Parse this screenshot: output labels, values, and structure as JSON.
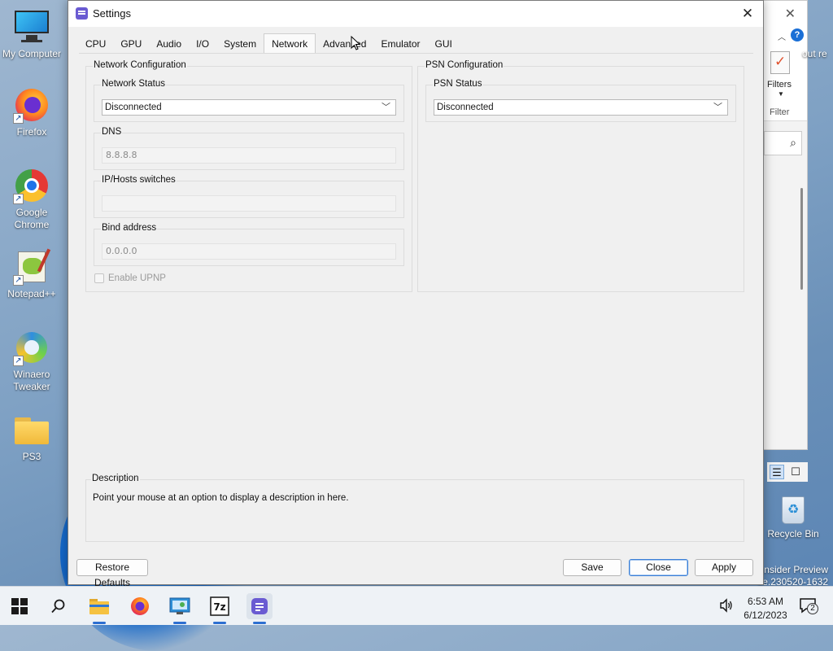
{
  "desktop": {
    "icons": [
      {
        "label": "My Computer",
        "icon": "computer-icon"
      },
      {
        "label": "Firefox",
        "icon": "firefox-icon"
      },
      {
        "label": "Google Chrome",
        "icon": "chrome-icon"
      },
      {
        "label": "Notepad++",
        "icon": "notepadpp-icon"
      },
      {
        "label": "Winaero Tweaker",
        "icon": "winaero-icon"
      },
      {
        "label": "PS3",
        "icon": "folder-icon"
      }
    ],
    "recycle_bin": "Recycle Bin",
    "partial_right_label": "out re",
    "watermark_line1": "Insider Preview",
    "watermark_line2": "se.230520-1632"
  },
  "background_window": {
    "filters_label": "Filters",
    "filter_group": "Filter",
    "help": "?"
  },
  "dialog": {
    "title": "Settings",
    "tabs": [
      "CPU",
      "GPU",
      "Audio",
      "I/O",
      "System",
      "Network",
      "Advanced",
      "Emulator",
      "GUI"
    ],
    "active_tab": "Network",
    "network_config": {
      "title": "Network Configuration",
      "status": {
        "label": "Network Status",
        "value": "Disconnected"
      },
      "dns": {
        "label": "DNS",
        "value": "8.8.8.8"
      },
      "hosts": {
        "label": "IP/Hosts switches",
        "value": ""
      },
      "bind": {
        "label": "Bind address",
        "value": "0.0.0.0"
      },
      "upnp": {
        "label": "Enable UPNP",
        "checked": false
      }
    },
    "psn_config": {
      "title": "PSN Configuration",
      "status": {
        "label": "PSN Status",
        "value": "Disconnected"
      }
    },
    "description": {
      "title": "Description",
      "text": "Point your mouse at an option to display a description in here."
    },
    "buttons": {
      "restore": "Restore Defaults",
      "save": "Save",
      "close": "Close",
      "apply": "Apply"
    }
  },
  "taskbar": {
    "apps": [
      "start-icon",
      "search-icon",
      "file-explorer-icon",
      "firefox-icon",
      "control-panel-icon",
      "7zip-icon",
      "rpcs3-icon"
    ],
    "time": "6:53 AM",
    "date": "6/12/2023",
    "notification_count": "2"
  }
}
